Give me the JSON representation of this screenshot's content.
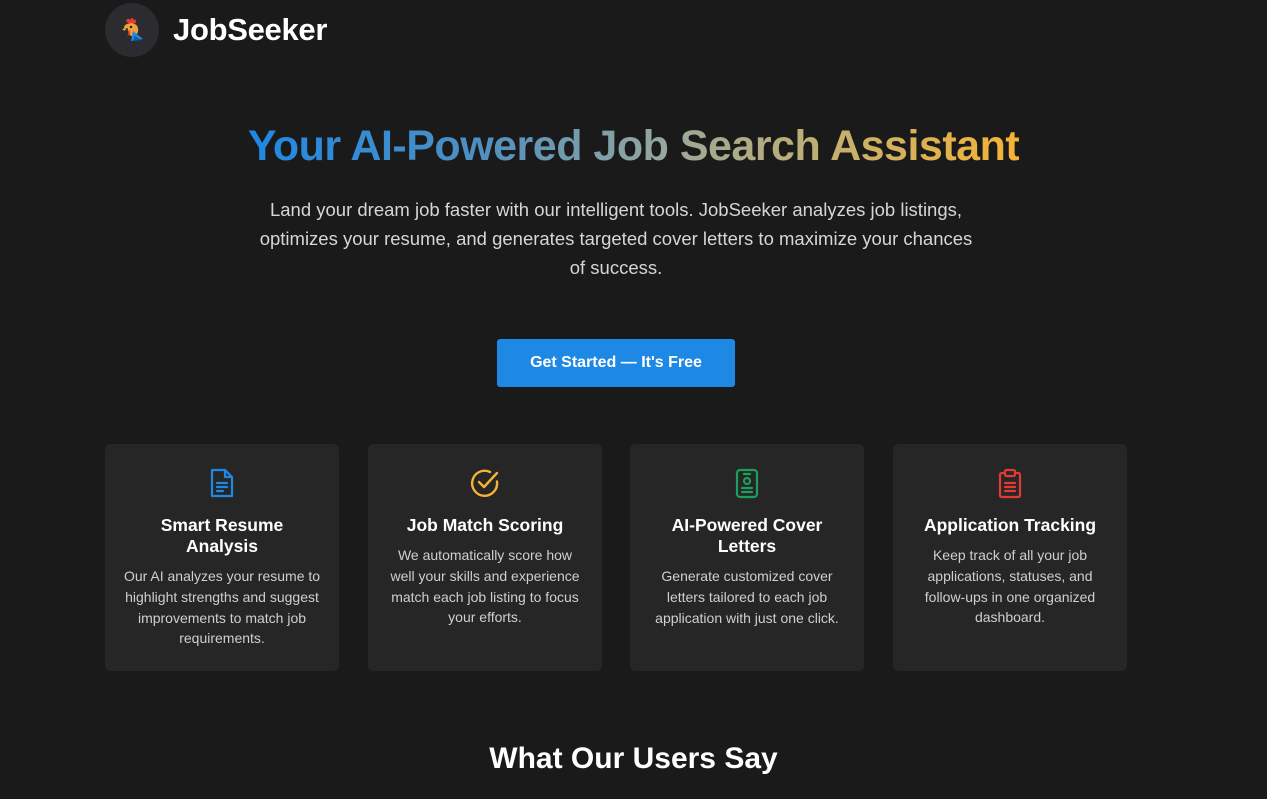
{
  "header": {
    "brand": "JobSeeker",
    "logo_icon": "rooster-logo-icon"
  },
  "hero": {
    "title": "Your AI-Powered Job Search Assistant",
    "subtitle": "Land your dream job faster with our intelligent tools. JobSeeker analyzes job listings, optimizes your resume, and generates targeted cover letters to maximize your chances of success.",
    "cta_label": "Get Started — It's Free"
  },
  "features": [
    {
      "icon": "document-icon",
      "icon_color": "#1e88e5",
      "title": "Smart Resume Analysis",
      "description": "Our AI analyzes your resume to highlight strengths and suggest improvements to match job requirements."
    },
    {
      "icon": "check-circle-icon",
      "icon_color": "#f5b335",
      "title": "Job Match Scoring",
      "description": "We automatically score how well your skills and experience match each job listing to focus your efforts."
    },
    {
      "icon": "id-badge-icon",
      "icon_color": "#1aa05a",
      "title": "AI-Powered Cover Letters",
      "description": "Generate customized cover letters tailored to each job application with just one click."
    },
    {
      "icon": "clipboard-icon",
      "icon_color": "#e53935",
      "title": "Application Tracking",
      "description": "Keep track of all your job applications, statuses, and follow-ups in one organized dashboard."
    }
  ],
  "testimonials": {
    "title": "What Our Users Say"
  },
  "colors": {
    "background": "#1a1a1a",
    "card": "#262626",
    "accent": "#1e88e5"
  }
}
